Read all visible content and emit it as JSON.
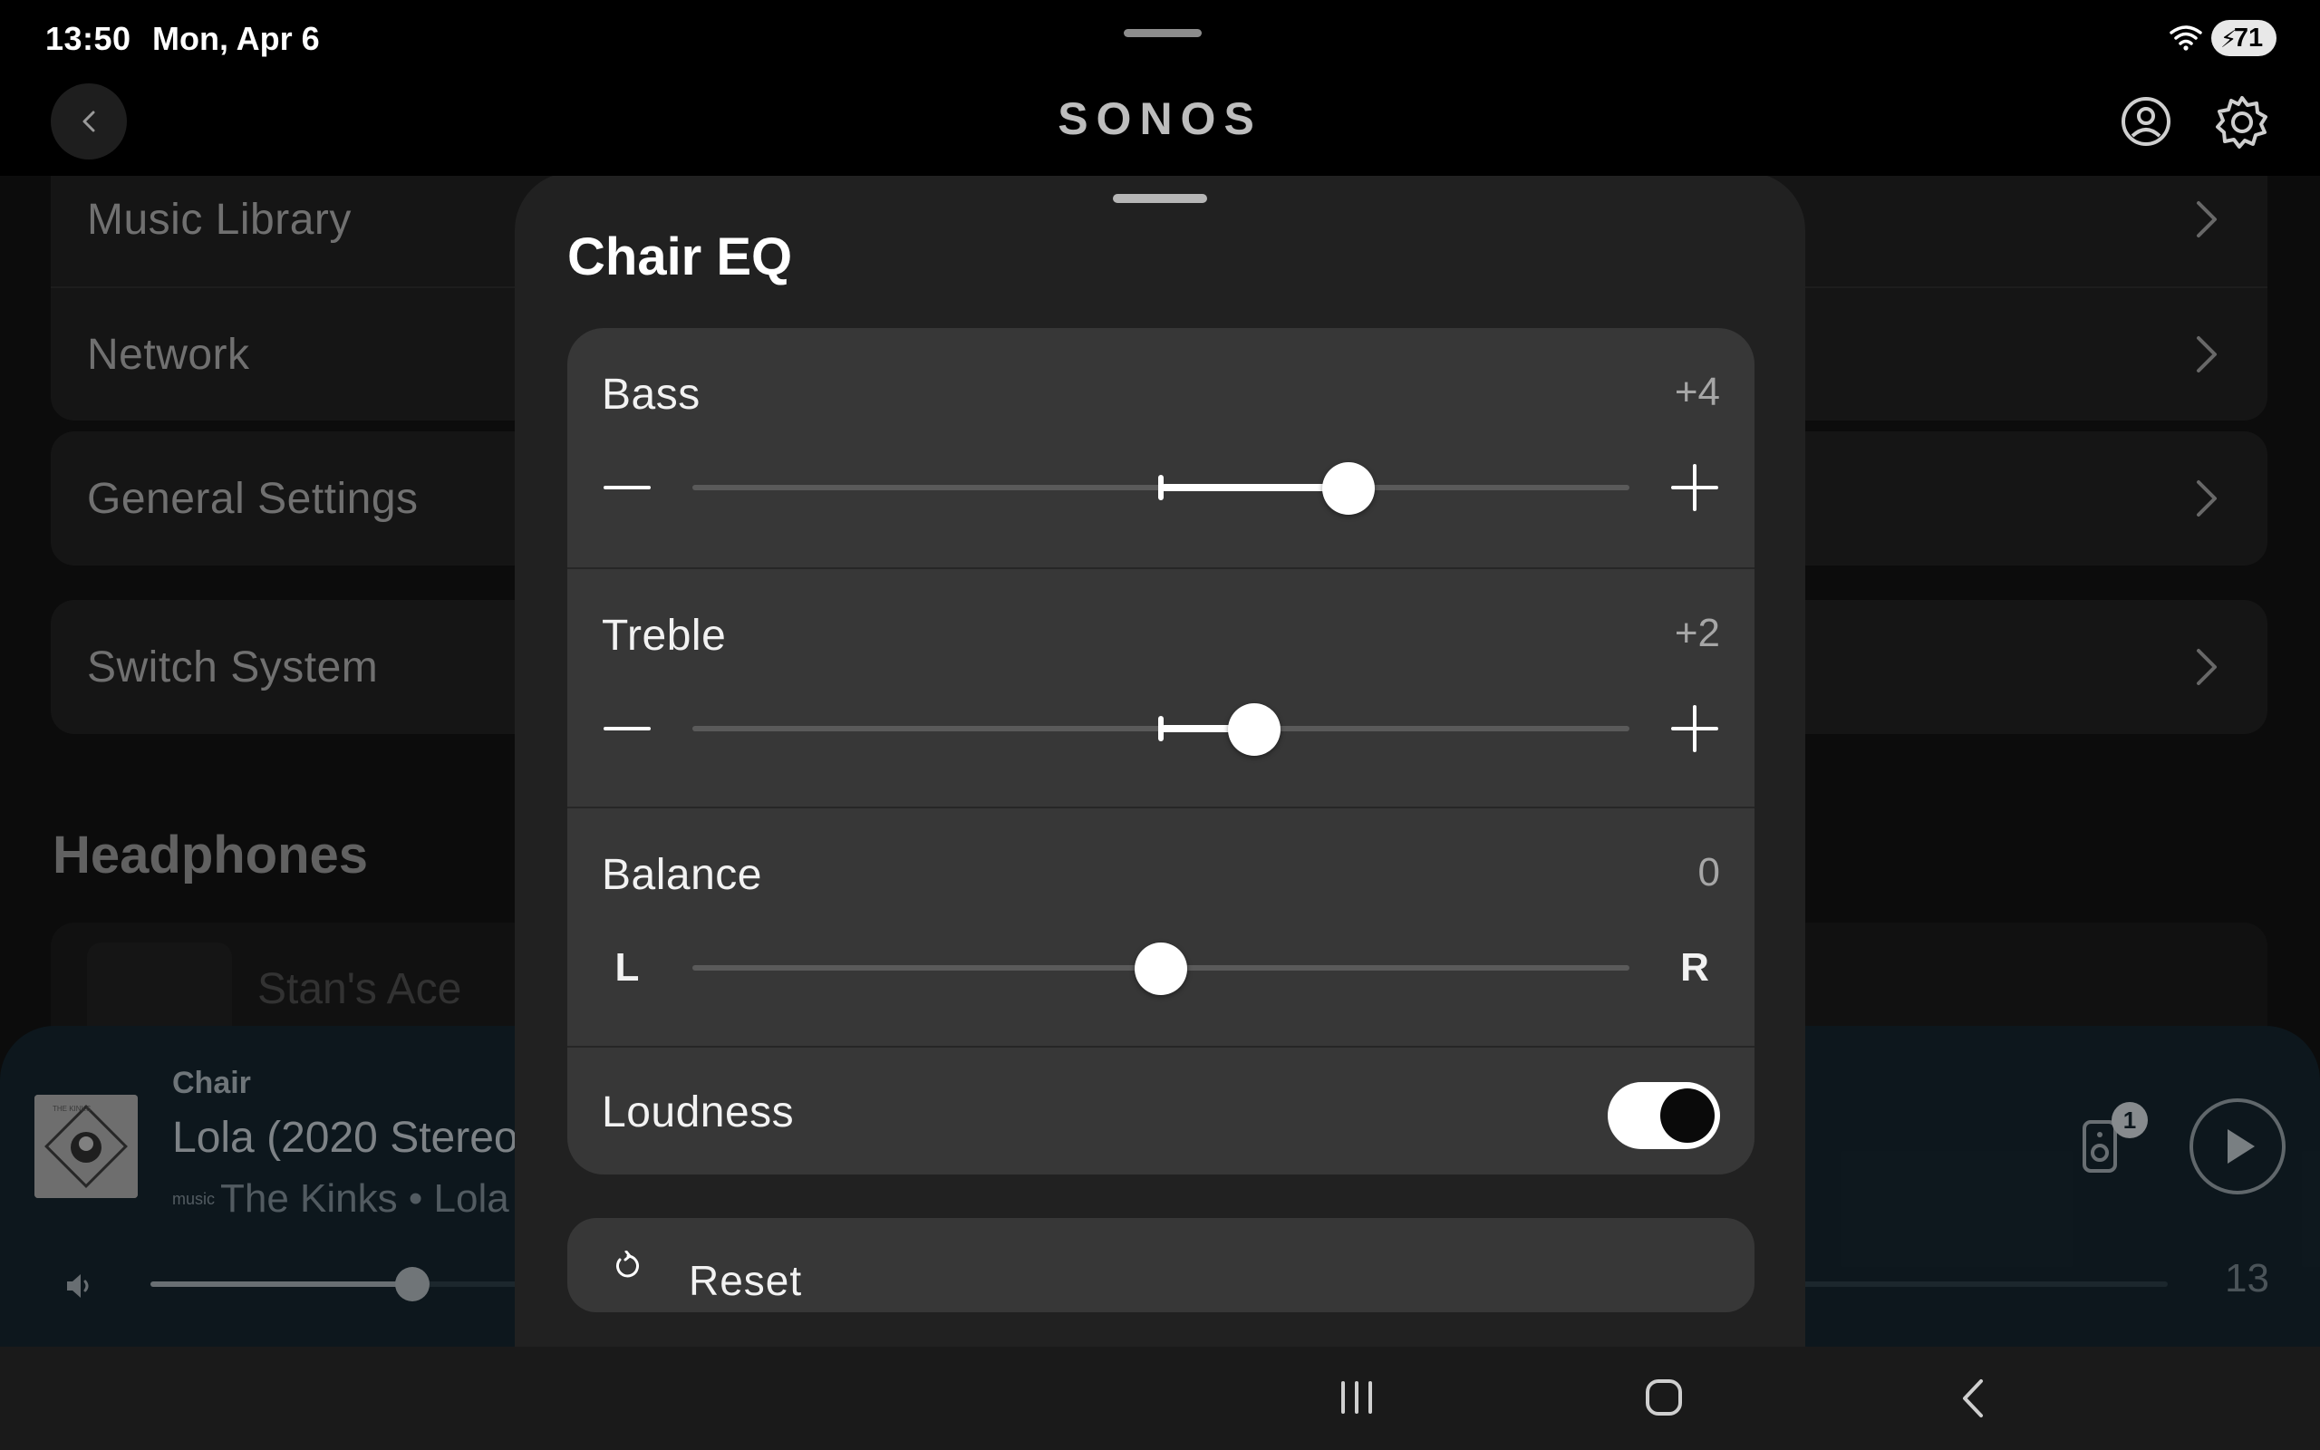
{
  "status_bar": {
    "time": "13:50",
    "date": "Mon, Apr 6",
    "battery": "71",
    "icons": [
      "wifi-icon",
      "battery-charging-icon"
    ]
  },
  "header": {
    "brand": "SONOS",
    "icons": [
      "back-icon",
      "account-icon",
      "settings-icon"
    ]
  },
  "settings_list": {
    "group1": [
      "Music Library",
      "Network"
    ],
    "general": "General Settings",
    "switch_system": "Switch System",
    "section_title": "Headphones",
    "headphones_item": "Stan's Ace"
  },
  "eq_sheet": {
    "title": "Chair EQ",
    "bass": {
      "label": "Bass",
      "value_text": "+4",
      "value": 4,
      "min": -10,
      "max": 10
    },
    "treble": {
      "label": "Treble",
      "value_text": "+2",
      "value": 2,
      "min": -10,
      "max": 10
    },
    "balance": {
      "label": "Balance",
      "value_text": "0",
      "value": 0,
      "min": -10,
      "max": 10,
      "left_label": "L",
      "right_label": "R"
    },
    "loudness": {
      "label": "Loudness",
      "enabled": true
    },
    "reset_label": "Reset"
  },
  "now_playing": {
    "room": "Chair",
    "title": "Lola (2020 Stereo",
    "service_label": "music",
    "subtitle": "The Kinks • Lola",
    "group_count": "1",
    "volume_value": "13",
    "volume_fraction": 0.13
  },
  "colors": {
    "sheet_bg": "#212121",
    "card_bg": "#373737",
    "now_playing_bg": "#14232c"
  }
}
